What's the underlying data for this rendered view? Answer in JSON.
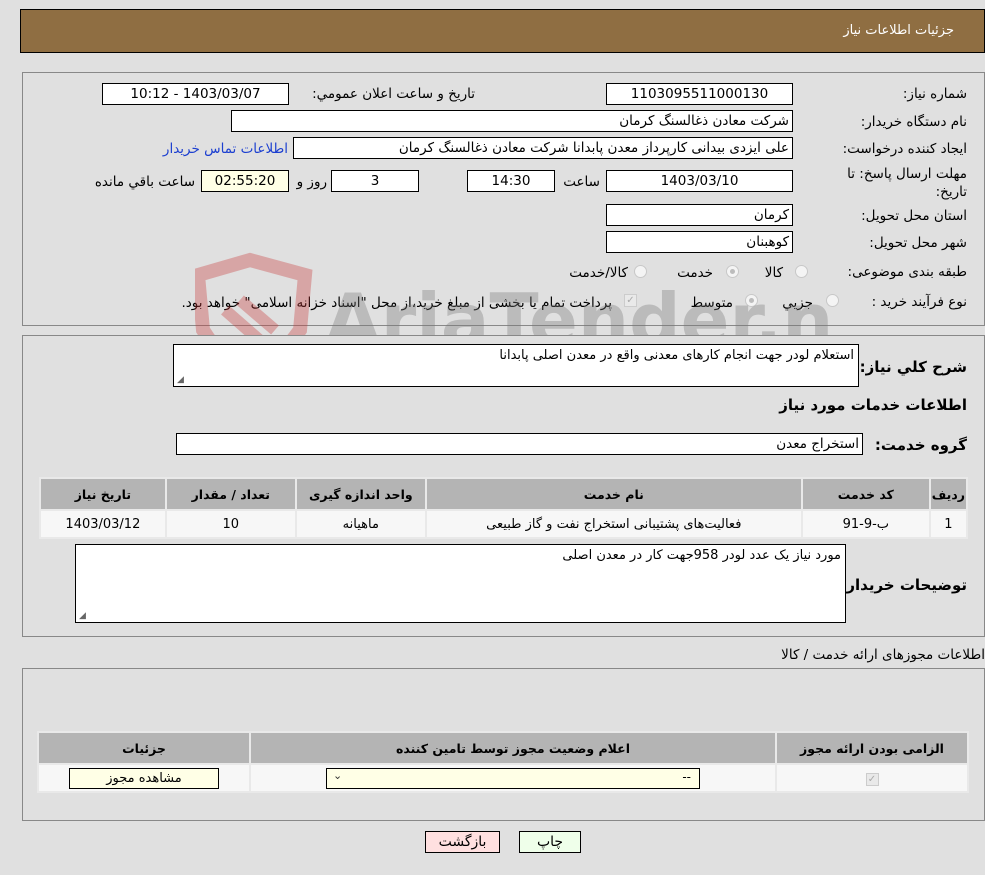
{
  "header": {
    "title": "جزئيات اطلاعات نياز"
  },
  "form": {
    "need_number_label": "شماره نیاز:",
    "need_number": "1103095511000130",
    "announce_label": "تاریخ و ساعت اعلان عمومي:",
    "announce_value": "1403/03/07 - 10:12",
    "buyer_org_label": "نام دستگاه خریدار:",
    "buyer_org": "شرکت معادن ذغالسنگ کرمان",
    "creator_label": "ایجاد کننده درخواست:",
    "creator": "علی ایزدی بیدانی کارپرداز معدن پابدانا شرکت معادن ذغالسنگ کرمان",
    "contact_link": "اطلاعات تماس خریدار",
    "deadline_label_1": "مهلت ارسال پاسخ: تا",
    "deadline_label_2": "تاریخ:",
    "deadline_date": "1403/03/10",
    "time_label": "ساعت",
    "deadline_time": "14:30",
    "days_value": "3",
    "days_label": "روز و",
    "remaining_time": "02:55:20",
    "remaining_label": "ساعت باقي مانده",
    "province_label": "استان محل تحویل:",
    "province": "کرمان",
    "city_label": "شهر محل تحویل:",
    "city": "کوهبنان",
    "category_label": "طبقه بندی موضوعی:",
    "category_options": [
      "کالا",
      "خدمت",
      "کالا/خدمت"
    ],
    "category_selected": "خدمت",
    "process_label": "نوع فرآیند خرید :",
    "process_options": [
      "جزيي",
      "متوسط"
    ],
    "process_selected": "متوسط",
    "treasury_note": "پرداخت تمام یا بخشی از مبلغ خرید،از محل \"اسناد خزانه اسلامی\" خواهد بود.",
    "treasury_checked": true
  },
  "description": {
    "label": "شرح کلي نياز:",
    "value": "استعلام لودر جهت انجام کارهای معدنی واقع در معدن اصلی پابدانا",
    "services_title": "اطلاعات خدمات مورد نیاز",
    "service_group_label": "گروه خدمت:",
    "service_group": "استخراج معدن"
  },
  "services_table": {
    "headers": [
      "ردیف",
      "کد خدمت",
      "نام خدمت",
      "واحد اندازه گیری",
      "تعداد / مقدار",
      "تاریخ نیاز"
    ],
    "rows": [
      [
        "1",
        "ب-9-91",
        "فعالیت‌های پشتیبانی استخراج نفت و گاز طبیعی",
        "ماهیانه",
        "10",
        "1403/03/12"
      ]
    ]
  },
  "buyer_notes": {
    "label": "توضیحات خریدار:",
    "value": "مورد نیاز یک عدد لودر 958جهت کار در معدن اصلی"
  },
  "permits": {
    "title": "اطلاعات مجوزهای ارائه خدمت / کالا",
    "headers": [
      "الزامی بودن ارائه مجوز",
      "اعلام وضعیت مجوز توسط تامین کننده",
      "جزئیات"
    ],
    "row": {
      "required_checked": true,
      "status_value": "--",
      "details_button": "مشاهده مجوز"
    }
  },
  "footer": {
    "print_button": "چاپ",
    "back_button": "بازگشت"
  },
  "watermark": {
    "text": "AriaTender.neT"
  }
}
